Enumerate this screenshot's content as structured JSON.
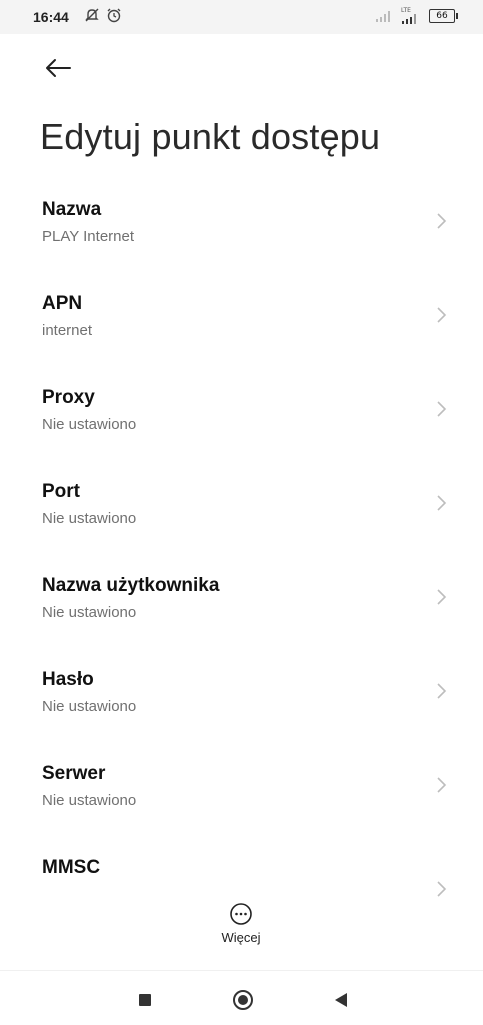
{
  "status_bar": {
    "time": "16:44",
    "battery_level": "66",
    "network_label": "LTE",
    "icons": [
      "notification-off-icon",
      "alarm-icon",
      "signal-icon",
      "lte-signal-icon",
      "battery-icon"
    ]
  },
  "header": {
    "back_icon": "arrow-left-icon",
    "title": "Edytuj punkt dostępu"
  },
  "items": [
    {
      "title": "Nazwa",
      "value": "PLAY Internet"
    },
    {
      "title": "APN",
      "value": "internet"
    },
    {
      "title": "Proxy",
      "value": "Nie ustawiono"
    },
    {
      "title": "Port",
      "value": "Nie ustawiono"
    },
    {
      "title": "Nazwa użytkownika",
      "value": "Nie ustawiono"
    },
    {
      "title": "Hasło",
      "value": "Nie ustawiono"
    },
    {
      "title": "Serwer",
      "value": "Nie ustawiono"
    },
    {
      "title": "MMSC",
      "value": ""
    }
  ],
  "footer": {
    "more_label": "Więcej",
    "more_icon": "more-horizontal-icon"
  },
  "nav_bar": {
    "icons": [
      "recent-apps-icon",
      "home-icon",
      "back-icon"
    ]
  }
}
